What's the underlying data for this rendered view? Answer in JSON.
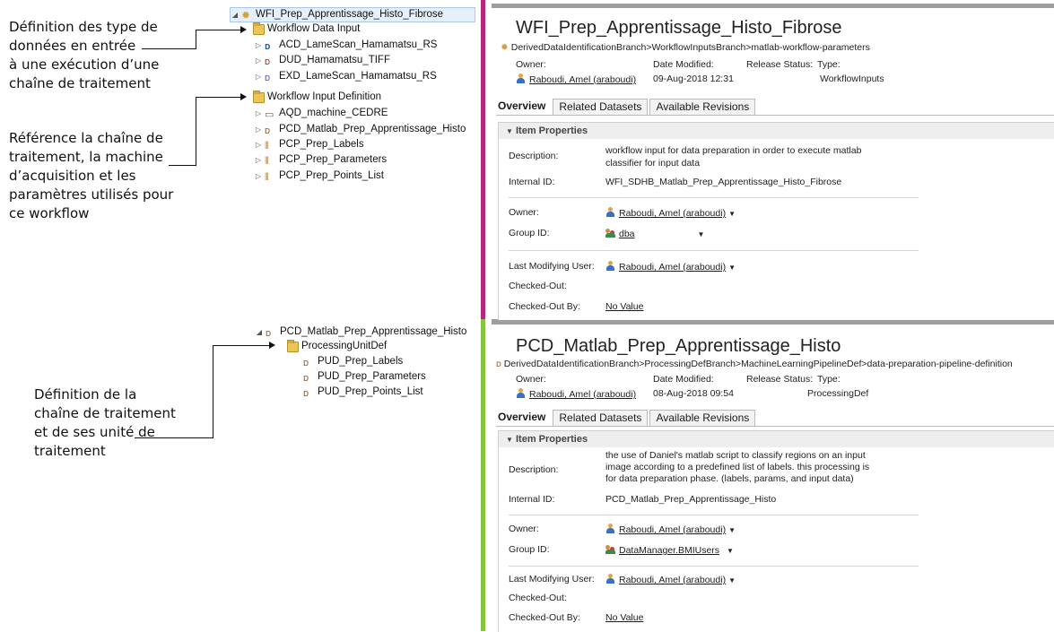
{
  "annotations": {
    "a1": [
      "Définition des type de",
      "données en entrée",
      "à une exécution d’une",
      "chaîne de traitement"
    ],
    "a2": [
      "Référence la chaîne de",
      "traitement, la machine",
      "d’acquisition et les",
      "paramètres utilisés pour",
      "ce workflow"
    ],
    "a3": [
      "Définition de la",
      "chaîne de traitement",
      "et de ses unité de",
      "traitement"
    ]
  },
  "tree_top": {
    "root": "WFI_Prep_Apprentissage_Histo_Fibrose",
    "group1": "Workflow Data Input",
    "group1_items": [
      "ACD_LameScan_Hamamatsu_RS",
      "DUD_Hamamatsu_TIFF",
      "EXD_LameScan_Hamamatsu_RS"
    ],
    "group2": "Workflow Input Definition",
    "group2_items": [
      "AQD_machine_CEDRE",
      "PCD_Matlab_Prep_Apprentissage_Histo",
      "PCP_Prep_Labels",
      "PCP_Prep_Parameters",
      "PCP_Prep_Points_List"
    ]
  },
  "tree_bottom": {
    "root": "PCD_Matlab_Prep_Apprentissage_Histo",
    "group": "ProcessingUnitDef",
    "items": [
      "PUD_Prep_Labels",
      "PUD_Prep_Parameters",
      "PUD_Prep_Points_List"
    ]
  },
  "panel1": {
    "title": "WFI_Prep_Apprentissage_Histo_Fibrose",
    "breadcrumb": "DerivedDataIdentificationBranch>WorkflowInputsBranch>matlab-workflow-parameters",
    "owner_label": "Owner:",
    "date_label": "Date Modified:",
    "release_label": "Release Status:",
    "type_label": "Type:",
    "owner": "Raboudi, Amel (araboudi)",
    "date": "09-Aug-2018 12:31",
    "type": "WorkflowInputs",
    "tabs": [
      "Overview",
      "Related Datasets",
      "Available Revisions"
    ],
    "section": "Item Properties",
    "desc_label": "Description:",
    "description": [
      "workflow input for data preparation in order to execute matlab",
      "classifier for input data"
    ],
    "internal_id_label": "Internal ID:",
    "internal_id": "WFI_SDHB_Matlab_Prep_Apprentissage_Histo_Fibrose",
    "owner2_label": "Owner:",
    "owner2": "Raboudi, Amel (araboudi)",
    "group_label": "Group ID:",
    "group": "dba",
    "lmu_label": "Last Modifying User:",
    "lmu": "Raboudi, Amel (araboudi)",
    "checked_out_label": "Checked-Out:",
    "checked_out_by_label": "Checked-Out By:",
    "checked_out_by": "No Value"
  },
  "panel2": {
    "title": "PCD_Matlab_Prep_Apprentissage_Histo",
    "breadcrumb": "DerivedDataIdentificationBranch>ProcessingDefBranch>MachineLearningPipelineDef>data-preparation-pipeline-definition",
    "owner_label": "Owner:",
    "date_label": "Date Modified:",
    "release_label": "Release Status:",
    "type_label": "Type:",
    "owner": "Raboudi, Amel (araboudi)",
    "date": "08-Aug-2018 09:54",
    "type": "ProcessingDef",
    "tabs": [
      "Overview",
      "Related Datasets",
      "Available Revisions"
    ],
    "section": "Item Properties",
    "desc_label": "Description:",
    "description": [
      "the use of Daniel's matlab script to classify regions on an input",
      "image according to a predefined list of labels. this processing is",
      "for data preparation phase. (labels, params, and input data)"
    ],
    "internal_id_label": "Internal ID:",
    "internal_id": "PCD_Matlab_Prep_Apprentissage_Histo",
    "owner2_label": "Owner:",
    "owner2": "Raboudi, Amel (araboudi)",
    "group_label": "Group ID:",
    "group": "DataManager.BMIUsers",
    "lmu_label": "Last Modifying User:",
    "lmu": "Raboudi, Amel (araboudi)",
    "checked_out_label": "Checked-Out:",
    "checked_out_by_label": "Checked-Out By:",
    "checked_out_by": "No Value"
  },
  "colors": {
    "divider_top": "#b5287a",
    "divider_bottom": "#86c440",
    "folder": "#e9c55a"
  }
}
